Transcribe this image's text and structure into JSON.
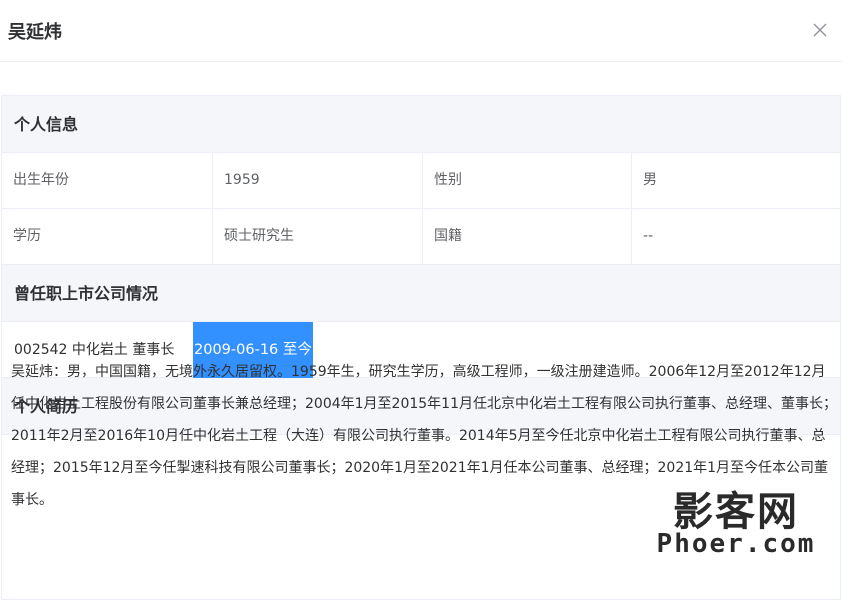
{
  "dialog": {
    "title": "吴延炜",
    "close_icon": "close-icon"
  },
  "personal_info": {
    "heading": "个人信息",
    "rows": [
      {
        "label1": "出生年份",
        "value1": "1959",
        "label2": "性别",
        "value2": "男"
      },
      {
        "label1": "学历",
        "value1": "硕士研究生",
        "label2": "国籍",
        "value2": "--"
      }
    ]
  },
  "positions": {
    "heading": "曾任职上市公司情况",
    "items": [
      {
        "company": "002542 中化岩土 董事长",
        "period": "2009-06-16 至今"
      }
    ]
  },
  "resume": {
    "heading": "个人简历",
    "text": "吴延炜：男，中国国籍，无境外永久居留权。1959年生，研究生学历，高级工程师，一级注册建造师。2006年12月至2012年12月任中化岩土工程股份有限公司董事长兼总经理；2004年1月至2015年11月任北京中化岩土工程有限公司执行董事、总经理、董事长；2011年2月至2016年10月任中化岩土工程（大连）有限公司执行董事。2014年5月至今任北京中化岩土工程有限公司执行董事、总经理；2015年12月至今任掣速科技有限公司董事长；2020年1月至2021年1月任本公司董事、总经理；2021年1月至今任本公司董事长。"
  },
  "watermark": {
    "logo": "影客网",
    "url": "Phoer.com"
  },
  "colors": {
    "selection_bg": "#3390ff",
    "section_bg": "#f5f6fa",
    "border": "#ebeef5"
  }
}
